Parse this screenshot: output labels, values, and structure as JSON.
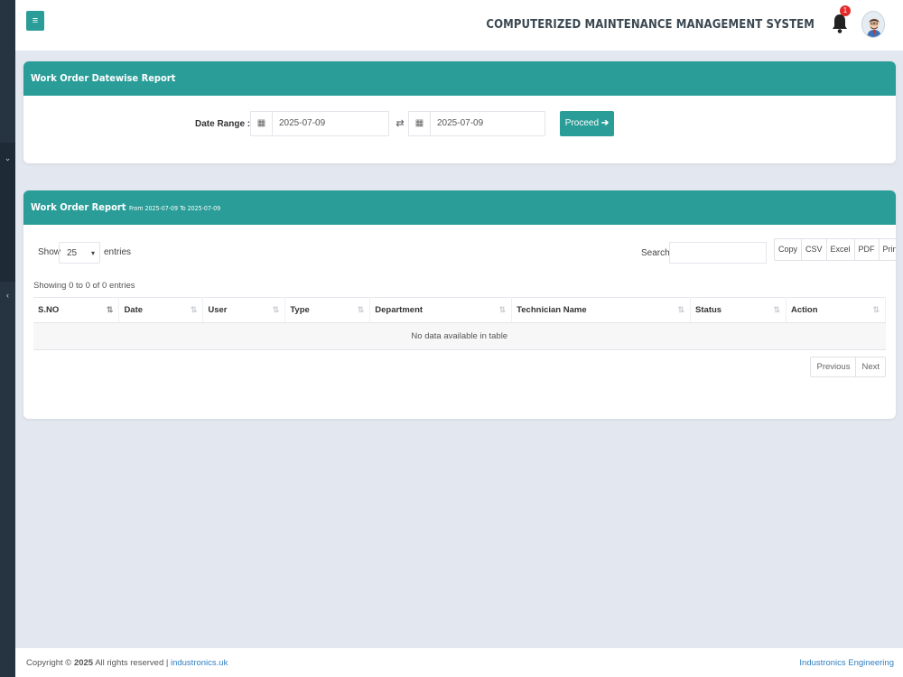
{
  "header": {
    "menu_icon": "≡",
    "title": "COMPUTERIZED MAINTENANCE MANAGEMENT SYSTEM",
    "notification_count": "1"
  },
  "sidebar": {
    "collapse_icon_top": "⌄",
    "collapse_icon_mid": "‹"
  },
  "date_card": {
    "title": "Work Order Datewise Report",
    "range_label": "Date Range :",
    "from_date": "2025-07-09",
    "to_date": "2025-07-09",
    "proceed_label": "Proceed"
  },
  "report_card": {
    "title": "Work Order Report",
    "subtitle": "From 2025-07-09 To 2025-07-09",
    "show_label": "Show",
    "length_value": "25",
    "entries_label": "entries",
    "search_label": "Search:",
    "search_value": "",
    "export_buttons": [
      "Copy",
      "CSV",
      "Excel",
      "PDF",
      "Print"
    ],
    "info": "Showing 0 to 0 of 0 entries",
    "columns": [
      "S.NO",
      "Date",
      "User",
      "Type",
      "Department",
      "Technician Name",
      "Status",
      "Action"
    ],
    "empty_message": "No data available in table",
    "previous_label": "Previous",
    "next_label": "Next"
  },
  "footer": {
    "copyright_prefix": "Copyright © ",
    "year": "2025",
    "rights": " All rights reserved | ",
    "link": "industronics.uk",
    "company": "Industronics Engineering"
  },
  "colors": {
    "accent": "#2a9d98",
    "sidebar": "#263340",
    "background": "#e3e7ef"
  }
}
